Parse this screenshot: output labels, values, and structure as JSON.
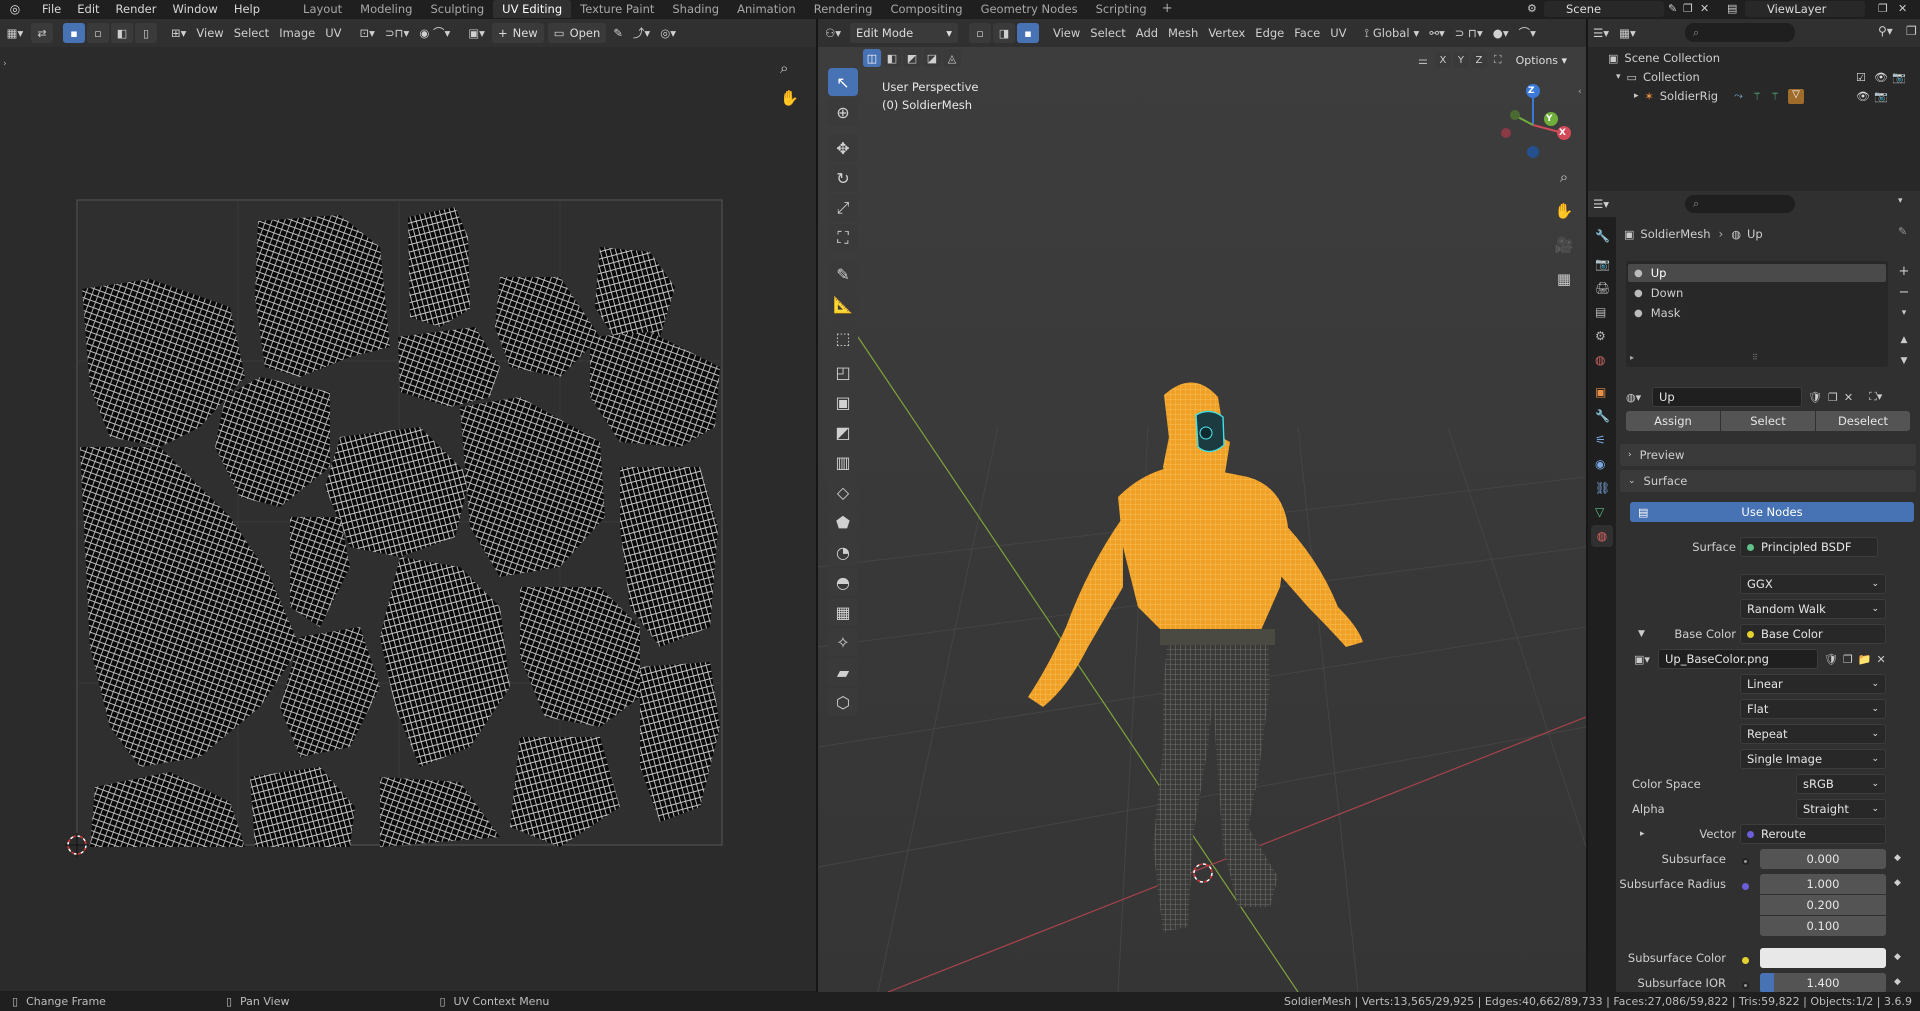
{
  "topbar": {
    "menus": [
      "File",
      "Edit",
      "Render",
      "Window",
      "Help"
    ],
    "workspaces": [
      "Layout",
      "Modeling",
      "Sculpting",
      "UV Editing",
      "Texture Paint",
      "Shading",
      "Animation",
      "Rendering",
      "Compositing",
      "Geometry Nodes",
      "Scripting"
    ],
    "active_workspace": "UV Editing",
    "plus": "+",
    "scene": "Scene",
    "view_layer": "ViewLayer"
  },
  "uv_editor": {
    "menus": [
      "View",
      "Select",
      "Image",
      "UV"
    ],
    "new_label": "New",
    "open_label": "Open"
  },
  "viewport": {
    "mode": "Edit Mode",
    "menus": [
      "View",
      "Select",
      "Add",
      "Mesh",
      "Vertex",
      "Edge",
      "Face",
      "UV"
    ],
    "orientation": "Global",
    "axes": [
      "X",
      "Y",
      "Z"
    ],
    "options_label": "Options",
    "overlay_title": "User Perspective",
    "overlay_object": "(0) SoldierMesh",
    "gizmo": {
      "z": "Z",
      "y": "Y",
      "x": "X"
    }
  },
  "outliner": {
    "scene_collection": "Scene Collection",
    "collection": "Collection",
    "object": "SoldierRig"
  },
  "properties": {
    "breadcrumb_object": "SoldierMesh",
    "breadcrumb_material": "Up",
    "slots": [
      "Up",
      "Down",
      "Mask"
    ],
    "material_name": "Up",
    "assign": "Assign",
    "select": "Select",
    "deselect": "Deselect",
    "preview": "Preview",
    "surface_panel": "Surface",
    "use_nodes": "Use Nodes",
    "surface_label": "Surface",
    "surface_value": "Principled BSDF",
    "distribution": "GGX",
    "subsurface_method": "Random Walk",
    "base_color_label": "Base Color",
    "base_color_value": "Base Color",
    "image_name": "Up_BaseColor.png",
    "interpolation": "Linear",
    "projection": "Flat",
    "extension": "Repeat",
    "source": "Single Image",
    "color_space_label": "Color Space",
    "color_space": "sRGB",
    "alpha_label": "Alpha",
    "alpha": "Straight",
    "vector_label": "Vector",
    "vector_value": "Reroute",
    "subsurface_label": "Subsurface",
    "subsurface_value": "0.000",
    "subsurface_radius_label": "Subsurface Radius",
    "radius": [
      "1.000",
      "0.200",
      "0.100"
    ],
    "subsurface_color_label": "Subsurface Color",
    "subsurface_ior_label": "Subsurface IOR",
    "subsurface_ior": "1.400"
  },
  "status": {
    "left": "Change Frame",
    "middle": "Pan View",
    "right": "UV Context Menu",
    "stats": "SoldierMesh | Verts:13,565/29,925 | Edges:40,662/89,733 | Faces:27,086/59,822 | Tris:59,822 | Objects:1/2 | 3.6.9"
  },
  "colors": {
    "accent": "#4772b3",
    "mesh_orange": "#f2a623",
    "selection": "#4772b3"
  }
}
